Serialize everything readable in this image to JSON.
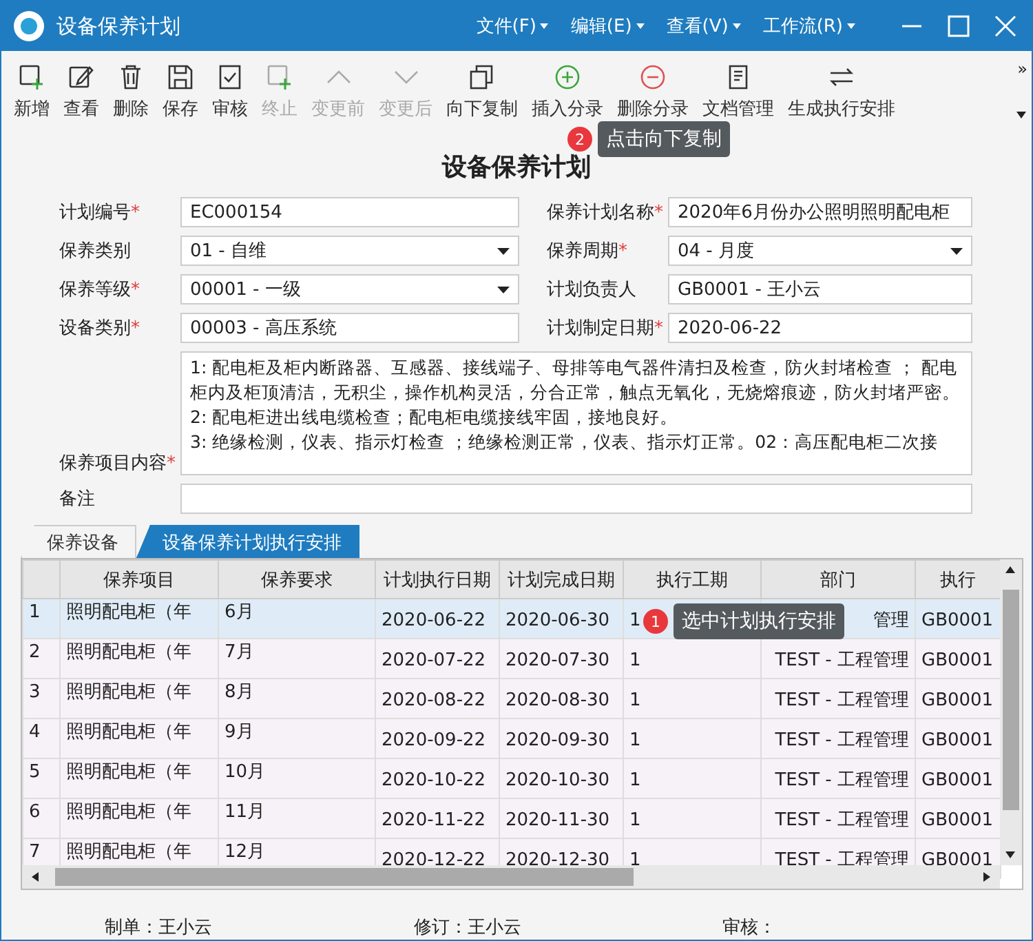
{
  "window": {
    "title": "设备保养计划",
    "menus": [
      "文件(F)",
      "编辑(E)",
      "查看(V)",
      "工作流(R)"
    ]
  },
  "toolbar": [
    {
      "label": "新增",
      "disabled": false
    },
    {
      "label": "查看",
      "disabled": false
    },
    {
      "label": "删除",
      "disabled": false
    },
    {
      "label": "保存",
      "disabled": false
    },
    {
      "label": "审核",
      "disabled": false
    },
    {
      "label": "终止",
      "disabled": true
    },
    {
      "label": "变更前",
      "disabled": true
    },
    {
      "label": "变更后",
      "disabled": true
    },
    {
      "label": "向下复制",
      "disabled": false
    },
    {
      "label": "插入分录",
      "disabled": false
    },
    {
      "label": "删除分录",
      "disabled": false
    },
    {
      "label": "文档管理",
      "disabled": false
    },
    {
      "label": "生成执行安排",
      "disabled": false
    }
  ],
  "toolbar_more": "»",
  "heading": "设备保养计划",
  "form": {
    "fields": [
      {
        "label": "计划编号",
        "marker": "*",
        "value": "EC000154",
        "kind": "text"
      },
      {
        "label": "保养计划名称",
        "marker": "*",
        "value": "2020年6月份办公照明照明配电柜",
        "kind": "text"
      },
      {
        "label": "保养类别",
        "value": "01 - 自维",
        "kind": "select"
      },
      {
        "label": "保养周期",
        "marker": "*",
        "value": "04 - 月度",
        "kind": "select"
      },
      {
        "label": "保养等级",
        "marker": "*",
        "value": "00001 - 一级",
        "kind": "select"
      },
      {
        "label": "计划负责人",
        "value": "GB0001 - 王小云",
        "kind": "text"
      },
      {
        "label": "设备类别",
        "marker": "*",
        "value": "00003 - 高压系统",
        "kind": "text"
      },
      {
        "label": "计划制定日期",
        "marker": "*",
        "value": "2020-06-22",
        "kind": "text"
      }
    ],
    "content": {
      "label": "保养项目内容",
      "marker": "*",
      "paragraphs": [
        "1: 配电柜及柜内断路器、互感器、接线端子、母排等电气器件清扫及检查，防火封堵检查 ； 配电柜内及柜顶清洁，无积尘，操作机构灵活，分合正常，触点无氧化，无烧熔痕迹，防火封堵严密。",
        "2: 配电柜进出线电缆检查；配电柜电缆接线牢固，接地良好。",
        "3: 绝缘检测，仪表、指示灯检查 ；绝缘检测正常，仪表、指示灯正常。02：高压配电柜二次接"
      ]
    },
    "remark": {
      "label": "备注"
    }
  },
  "tabs": [
    {
      "label": "保养设备",
      "selected": false
    },
    {
      "label": "设备保养计划执行安排",
      "selected": true
    }
  ],
  "table": {
    "columns": [
      "",
      "保养项目",
      "保养要求",
      "计划执行日期",
      "计划完成日期",
      "执行工期",
      "部门",
      "执行"
    ],
    "rows": [
      {
        "selected": true,
        "cells": [
          "1",
          "照明配电柜（年",
          "6月",
          "2020-06-22",
          "2020-06-30",
          "1",
          "管理",
          "GB0001"
        ]
      },
      {
        "selected": false,
        "cells": [
          "2",
          "照明配电柜（年",
          "7月",
          "2020-07-22",
          "2020-07-30",
          "1",
          "TEST - 工程管理",
          "GB0001"
        ]
      },
      {
        "selected": false,
        "cells": [
          "3",
          "照明配电柜（年",
          "8月",
          "2020-08-22",
          "2020-08-30",
          "1",
          "TEST - 工程管理",
          "GB0001"
        ]
      },
      {
        "selected": false,
        "cells": [
          "4",
          "照明配电柜（年",
          "9月",
          "2020-09-22",
          "2020-09-30",
          "1",
          "TEST - 工程管理",
          "GB0001"
        ]
      },
      {
        "selected": false,
        "cells": [
          "5",
          "照明配电柜（年",
          "10月",
          "2020-10-22",
          "2020-10-30",
          "1",
          "TEST - 工程管理",
          "GB0001"
        ]
      },
      {
        "selected": false,
        "cells": [
          "6",
          "照明配电柜（年",
          "11月",
          "2020-11-22",
          "2020-11-30",
          "1",
          "TEST - 工程管理",
          "GB0001"
        ]
      },
      {
        "selected": false,
        "cells": [
          "7",
          "照明配电柜（年",
          "12月",
          "2020-12-22",
          "2020-12-30",
          "1",
          "TEST - 工程管理",
          "GB0001"
        ]
      }
    ]
  },
  "footer": [
    "制单：王小云",
    "修订：王小云",
    "审核："
  ],
  "tooltips": [
    {
      "number": "2",
      "text": "点击向下复制"
    },
    {
      "number": "1",
      "text": "选中计划执行安排"
    }
  ]
}
